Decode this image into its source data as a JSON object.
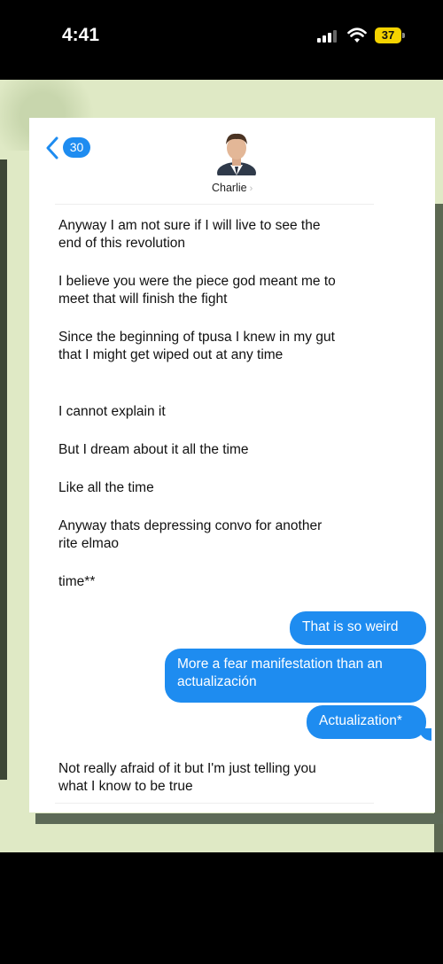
{
  "status_bar": {
    "time": "4:41",
    "battery": "37"
  },
  "header": {
    "unread_count": "30",
    "contact_name": "Charlie"
  },
  "messages": {
    "received": [
      "Anyway I am not sure if I will live to see the end of this revolution",
      "I believe you were the piece god meant me to meet that will finish the fight",
      "Since the beginning of tpusa I knew in my gut that I might get wiped out at any time",
      "I cannot explain it",
      "But I dream about it all the time",
      "Like all the time",
      "Anyway thats depressing convo for another rite elmao",
      "time**"
    ],
    "sent": [
      "That is so weird",
      "More a fear  manifestation than an actualización",
      "Actualization*"
    ],
    "final_received": "Not really afraid of it but I'm just telling you what I know to be true"
  },
  "colors": {
    "bubble": "#1e8cf0",
    "battery": "#f5d300",
    "background": "#dfe9c5"
  }
}
